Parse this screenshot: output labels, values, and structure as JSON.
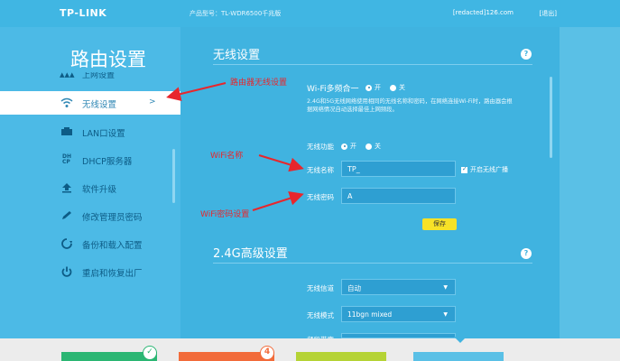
{
  "header": {
    "logo": "TP-LINK",
    "model": "产品型号：TL-WDR6500千兆版",
    "account": "[redacted]126.com",
    "logout": "[退出]"
  },
  "sidebar": {
    "title": "路由设置",
    "partial_item": "上网设置",
    "items": [
      {
        "label": "无线设置",
        "icon": "wifi-icon",
        "active": true
      },
      {
        "label": "LAN口设置",
        "icon": "lan-icon"
      },
      {
        "label": "DHCP服务器",
        "icon": "dhcp-icon"
      },
      {
        "label": "软件升级",
        "icon": "upgrade-icon"
      },
      {
        "label": "修改管理员密码",
        "icon": "pencil-icon"
      },
      {
        "label": "备份和载入配置",
        "icon": "backup-icon"
      },
      {
        "label": "重启和恢复出厂",
        "icon": "power-icon"
      }
    ]
  },
  "wireless": {
    "section_title": "无线设置",
    "multi_label": "Wi-Fi多频合一",
    "on": "开",
    "off": "关",
    "description": "2.4G和5G无线网络使用相同的无线名称和密码，在网络连接Wi-Fi时，路由器会根据网络情况自动选择最佳上网频段。",
    "function_label": "无线功能",
    "ssid_label": "无线名称",
    "ssid_value": "TP_",
    "password_label": "无线密码",
    "password_value": "A",
    "broadcast_label": "开启无线广播",
    "save_label": "保存"
  },
  "advanced": {
    "section_title": "2.4G高级设置",
    "channel_label": "无线信道",
    "channel_value": "自动",
    "mode_label": "无线模式",
    "mode_value": "11bgn mixed",
    "bandwidth_label": "频段带宽"
  },
  "annotations": {
    "router_wireless": "路由器无线设置",
    "wifi_name": "WiFi名称",
    "wifi_password": "WiFi密码设置"
  },
  "footer": {
    "badge_check": "✓",
    "badge_count": "4",
    "tile_colors": [
      "#2bb673",
      "#f26b3a",
      "#b5d335",
      "#5ac0e6"
    ]
  },
  "colors": {
    "accent": "#40b3e0",
    "annotation_red": "#e8262c",
    "save_yellow": "#f7e227"
  }
}
